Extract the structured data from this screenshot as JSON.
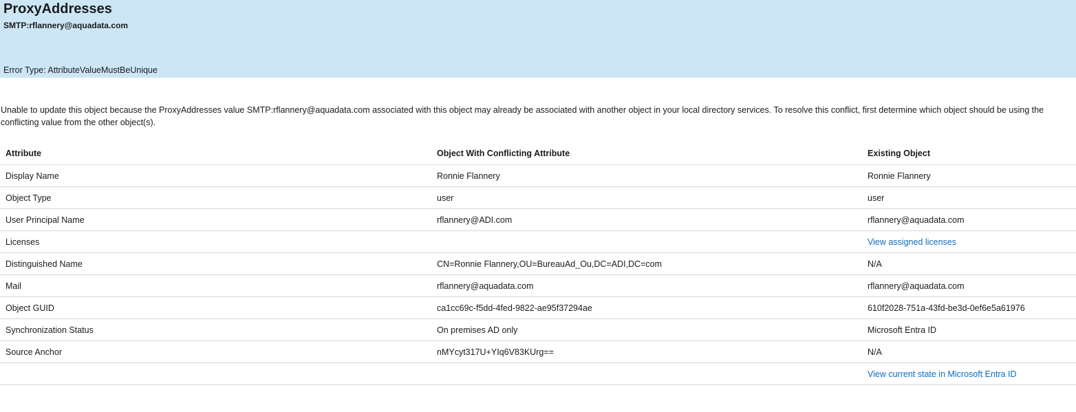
{
  "header": {
    "title": "ProxyAddresses",
    "subtitle": "SMTP:rflannery@aquadata.com",
    "error_type": "Error Type: AttributeValueMustBeUnique"
  },
  "description": {
    "line1": "Unable to update this object because the ProxyAddresses value SMTP:rflannery@aquadata.com associated with this object may already be associated with another object in your local directory services. To resolve this conflict, first determine which object should be using the",
    "line2": "conflicting value from the other object(s)."
  },
  "table": {
    "headers": [
      "Attribute",
      "Object With Conflicting Attribute",
      "Existing Object"
    ],
    "rows": [
      {
        "attribute": "Display Name",
        "conflicting": "Ronnie Flannery",
        "existing": "Ronnie Flannery"
      },
      {
        "attribute": "Object Type",
        "conflicting": "user",
        "existing": "user"
      },
      {
        "attribute": "User Principal Name",
        "conflicting": "rflannery@ADI.com",
        "existing": "rflannery@aquadata.com"
      },
      {
        "attribute": "Licenses",
        "conflicting": "",
        "existing": "View assigned licenses"
      },
      {
        "attribute": "Distinguished Name",
        "conflicting": "CN=Ronnie Flannery,OU=BureauAd_Ou,DC=ADI,DC=com",
        "existing": "N/A"
      },
      {
        "attribute": "Mail",
        "conflicting": "rflannery@aquadata.com",
        "existing": "rflannery@aquadata.com"
      },
      {
        "attribute": "Object GUID",
        "conflicting": "ca1cc69c-f5dd-4fed-9822-ae95f37294ae",
        "existing": "610f2028-751a-43fd-be3d-0ef6e5a61976"
      },
      {
        "attribute": "Synchronization Status",
        "conflicting": "On premises AD only",
        "existing": "Microsoft Entra ID"
      },
      {
        "attribute": "Source Anchor",
        "conflicting": "nMYcyt317U+YIq6V83KUrg==",
        "existing": "N/A"
      },
      {
        "attribute": "",
        "conflicting": "",
        "existing": "View current state in Microsoft Entra ID"
      }
    ]
  },
  "colors": {
    "header_background": "#cce6f5",
    "link": "#0f6cbd",
    "text": "#1b1b1b",
    "row_border": "#d6d6d6"
  }
}
